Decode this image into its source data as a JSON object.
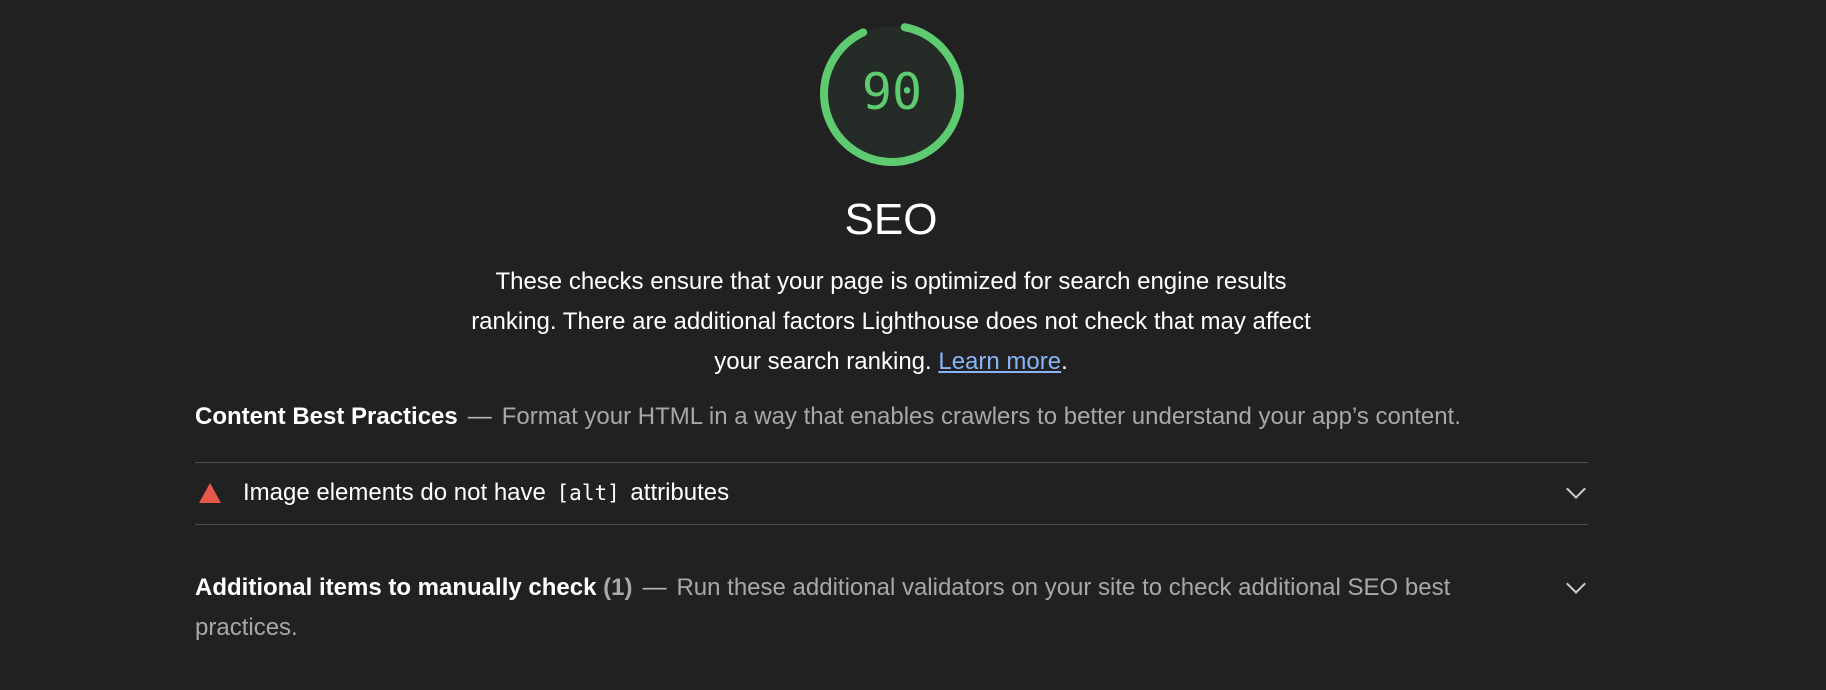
{
  "score": {
    "value": 90,
    "label": "90",
    "color": "#5ecb71"
  },
  "category": {
    "title": "SEO",
    "description": "These checks ensure that your page is optimized for search engine results ranking. There are additional factors Lighthouse does not check that may affect your search ranking.",
    "learn_more": "Learn more",
    "trailing": "."
  },
  "group": {
    "title": "Content Best Practices",
    "separator": "—",
    "description": "Format your HTML in a way that enables crawlers to better understand your app’s content."
  },
  "audit": {
    "icon": "warning-triangle-icon",
    "status_color": "#e8584a",
    "title_before": "Image elements do not have",
    "title_code": "[alt]",
    "title_after": "attributes"
  },
  "manual": {
    "title": "Additional items to manually check",
    "count": "(1)",
    "separator": "—",
    "description": "Run these additional validators on your site to check additional SEO best practices."
  }
}
